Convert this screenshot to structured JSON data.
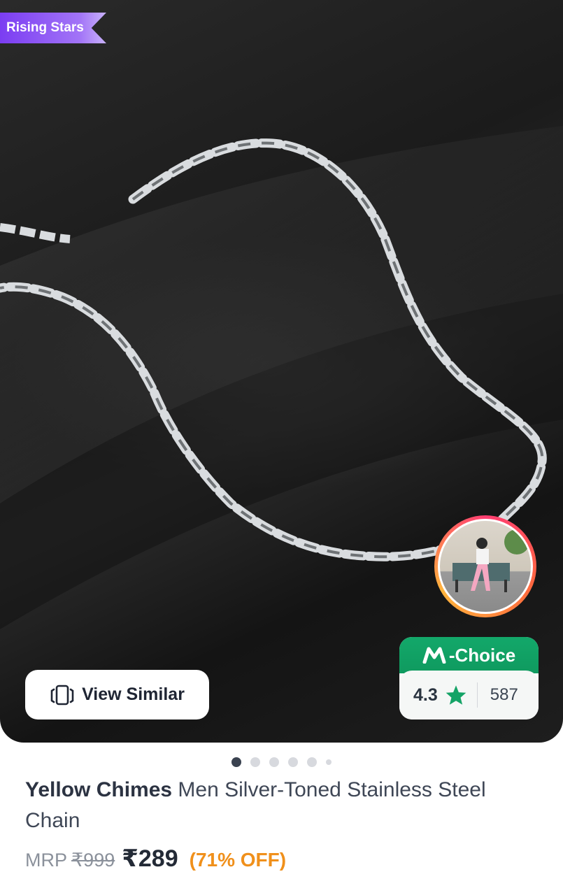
{
  "badge": {
    "label": "Rising Stars"
  },
  "image": {
    "icon": "product-chain-photo"
  },
  "view_similar": {
    "label": "View Similar",
    "icon": "view-similar-icon"
  },
  "m_choice": {
    "label": "-Choice",
    "logo": "M",
    "rating": "4.3",
    "rating_count": "587",
    "accent": "#13a86a"
  },
  "carousel": {
    "total": 6,
    "active_index": 0
  },
  "product": {
    "brand": "Yellow Chimes",
    "name": "Men Silver-Toned Stainless Steel Chain"
  },
  "pricing": {
    "mrp_label": "MRP",
    "mrp": "₹999",
    "price": "₹289",
    "discount": "(71% OFF)",
    "discount_color": "#f0901b"
  }
}
